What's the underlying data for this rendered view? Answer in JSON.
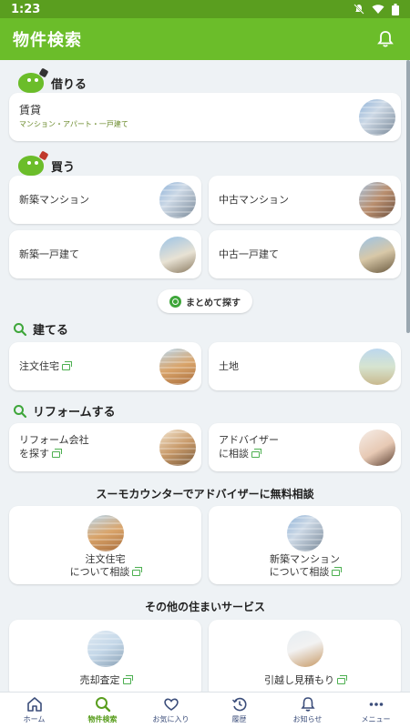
{
  "status": {
    "time": "1:23"
  },
  "app": {
    "title": "物件検索"
  },
  "rent": {
    "heading": "借りる",
    "card": {
      "title": "賃貸",
      "subtitle": "マンション・アパート・一戸建て"
    }
  },
  "buy": {
    "heading": "買う",
    "cards": [
      {
        "title": "新築マンション"
      },
      {
        "title": "中古マンション"
      },
      {
        "title": "新築一戸建て"
      },
      {
        "title": "中古一戸建て"
      }
    ],
    "bulk_search": "まとめて探す"
  },
  "build": {
    "heading": "建てる",
    "cards": [
      {
        "title": "注文住宅"
      },
      {
        "title": "土地"
      }
    ]
  },
  "reform": {
    "heading": "リフォームする",
    "cards": [
      {
        "line1": "リフォーム会社",
        "line2": "を探す"
      },
      {
        "line1": "アドバイザー",
        "line2": "に相談"
      }
    ]
  },
  "counter": {
    "heading": "スーモカウンターでアドバイザーに無料相談",
    "cards": [
      {
        "line1": "注文住宅",
        "line2": "について相談"
      },
      {
        "line1": "新築マンション",
        "line2": "について相談"
      }
    ]
  },
  "other": {
    "heading": "その他の住まいサービス",
    "cards": [
      {
        "title": "売却査定"
      },
      {
        "title": "引越し見積もり"
      }
    ]
  },
  "nav": [
    {
      "label": "ホーム",
      "icon": "home-icon"
    },
    {
      "label": "物件検索",
      "icon": "search-icon"
    },
    {
      "label": "お気に入り",
      "icon": "heart-icon"
    },
    {
      "label": "履歴",
      "icon": "history-icon"
    },
    {
      "label": "お知らせ",
      "icon": "bell-icon"
    },
    {
      "label": "メニュー",
      "icon": "more-icon"
    }
  ],
  "colors": {
    "brand": "#6bbd2a",
    "status_bar": "#5a9e1f",
    "background": "#eef2f5",
    "accent_green": "#3ea63a",
    "nav_text": "#3b4d7a"
  }
}
